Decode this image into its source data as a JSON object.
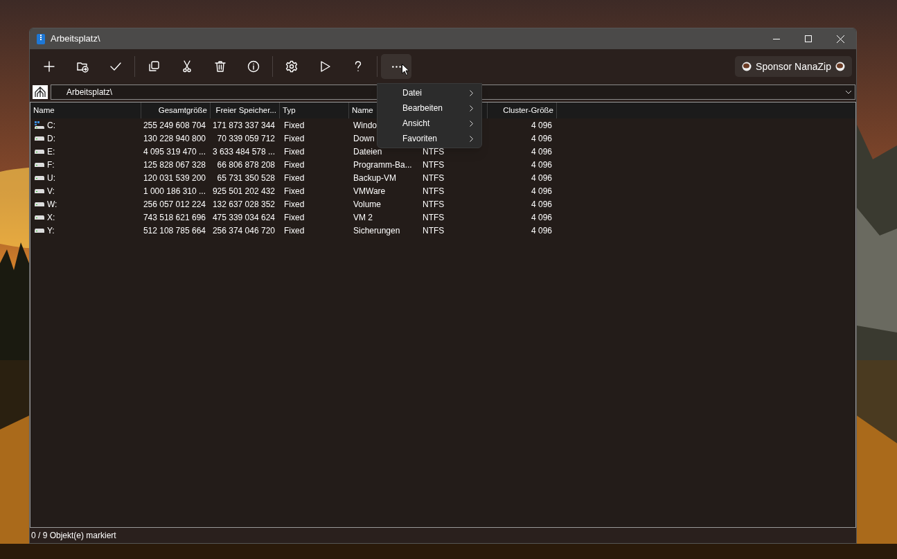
{
  "window": {
    "title": "Arbeitsplatz\\"
  },
  "toolbar": [
    {
      "kind": "add",
      "active": false
    },
    {
      "kind": "extract",
      "active": false
    },
    {
      "kind": "test",
      "active": false
    },
    {
      "kind": "separator"
    },
    {
      "kind": "copy",
      "active": false
    },
    {
      "kind": "move",
      "active": false
    },
    {
      "kind": "delete",
      "active": false
    },
    {
      "kind": "info",
      "active": false
    },
    {
      "kind": "separator"
    },
    {
      "kind": "settings",
      "active": false
    },
    {
      "kind": "run",
      "active": false
    },
    {
      "kind": "help",
      "active": false
    },
    {
      "kind": "separator"
    },
    {
      "kind": "more",
      "active": true
    }
  ],
  "sponsor_button": {
    "label": "Sponsor NanaZip"
  },
  "address_bar": {
    "value": "Arbeitsplatz\\"
  },
  "table": {
    "columns": [
      {
        "label": "Name"
      },
      {
        "label": "Gesamtgröße"
      },
      {
        "label": "Freier Speicher..."
      },
      {
        "label": "Typ"
      },
      {
        "label": "Name"
      },
      {},
      {
        "label": "Cluster-Größe"
      }
    ],
    "rows": [
      {
        "kind": "system",
        "cells": [
          "C:",
          "255 249 608 704",
          "171 873 337 344",
          "Fixed",
          "Windo",
          null,
          "4 096"
        ]
      },
      {
        "kind": "drive",
        "cells": [
          "D:",
          "130 228 940 800",
          "70 339 059 712",
          "Fixed",
          "Down",
          null,
          "4 096"
        ]
      },
      {
        "kind": "drive",
        "cells": [
          "E:",
          "4 095 319 470 ...",
          "3 633 484 578 ...",
          "Fixed",
          "Dateien",
          "NTFS",
          "4 096"
        ]
      },
      {
        "kind": "drive",
        "cells": [
          "F:",
          "125 828 067 328",
          "66 806 878 208",
          "Fixed",
          "Programm-Ba...",
          "NTFS",
          "4 096"
        ]
      },
      {
        "kind": "drive",
        "cells": [
          "U:",
          "120 031 539 200",
          "65 731 350 528",
          "Fixed",
          "Backup-VM",
          "NTFS",
          "4 096"
        ]
      },
      {
        "kind": "drive",
        "cells": [
          "V:",
          "1 000 186 310 ...",
          "925 501 202 432",
          "Fixed",
          "VMWare",
          "NTFS",
          "4 096"
        ]
      },
      {
        "kind": "drive",
        "cells": [
          "W:",
          "256 057 012 224",
          "132 637 028 352",
          "Fixed",
          "Volume",
          "NTFS",
          "4 096"
        ]
      },
      {
        "kind": "drive",
        "cells": [
          "X:",
          "743 518 621 696",
          "475 339 034 624",
          "Fixed",
          "VM 2",
          "NTFS",
          "4 096"
        ]
      },
      {
        "kind": "drive",
        "cells": [
          "Y:",
          "512 108 785 664",
          "256 374 046 720",
          "Fixed",
          "Sicherungen",
          "NTFS",
          "4 096"
        ]
      }
    ]
  },
  "menu": {
    "items": [
      {
        "label": "Datei",
        "submenu": true
      },
      {
        "label": "Bearbeiten",
        "submenu": true
      },
      {
        "label": "Ansicht",
        "submenu": true
      },
      {
        "label": "Favoriten",
        "submenu": true
      }
    ]
  },
  "status_bar": {
    "text": "0 / 9 Objekt(e) markiert"
  }
}
